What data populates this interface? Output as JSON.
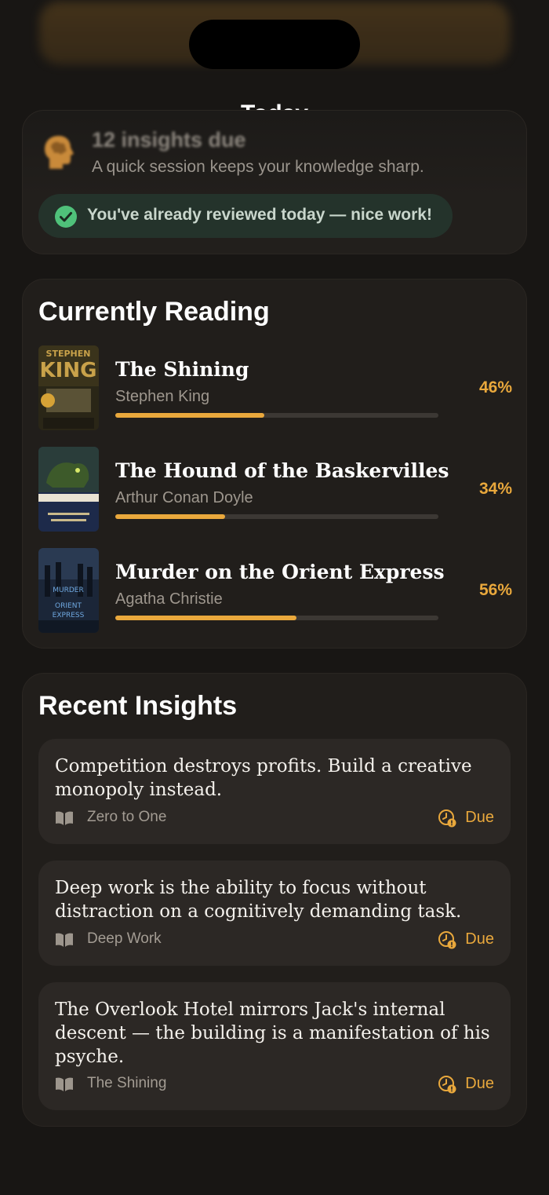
{
  "nav": {
    "title": "Today"
  },
  "today": {
    "due_count": "12 insights due",
    "subtitle": "A quick session keeps your knowledge sharp.",
    "reviewed_message": "You've already reviewed today — nice work!"
  },
  "reading": {
    "title": "Currently Reading",
    "books": [
      {
        "title": "The Shining",
        "author": "Stephen King",
        "percent_label": "46%",
        "progress": 0.46,
        "cover_icon": "book-cover-the-shining"
      },
      {
        "title": "The Hound of the Baskervilles",
        "author": "Arthur Conan Doyle",
        "percent_label": "34%",
        "progress": 0.34,
        "cover_icon": "book-cover-hound"
      },
      {
        "title": "Murder on the Orient Express",
        "author": "Agatha Christie",
        "percent_label": "56%",
        "progress": 0.56,
        "cover_icon": "book-cover-orient-express"
      }
    ]
  },
  "insights": {
    "title": "Recent Insights",
    "items": [
      {
        "text": "Competition destroys profits. Build a creative monopoly instead.",
        "book": "Zero to One",
        "status": "Due"
      },
      {
        "text": "Deep work is the ability to focus without distraction on a cognitively demanding task.",
        "book": "Deep Work",
        "status": "Due"
      },
      {
        "text": "The Overlook Hotel mirrors Jack's internal descent — the building is a manifestation of his psyche.",
        "book": "The Shining",
        "status": "Due"
      }
    ]
  },
  "colors": {
    "accent": "#e9a83c",
    "success": "#4fc17a",
    "card": "#211e1b",
    "background": "#181614"
  }
}
